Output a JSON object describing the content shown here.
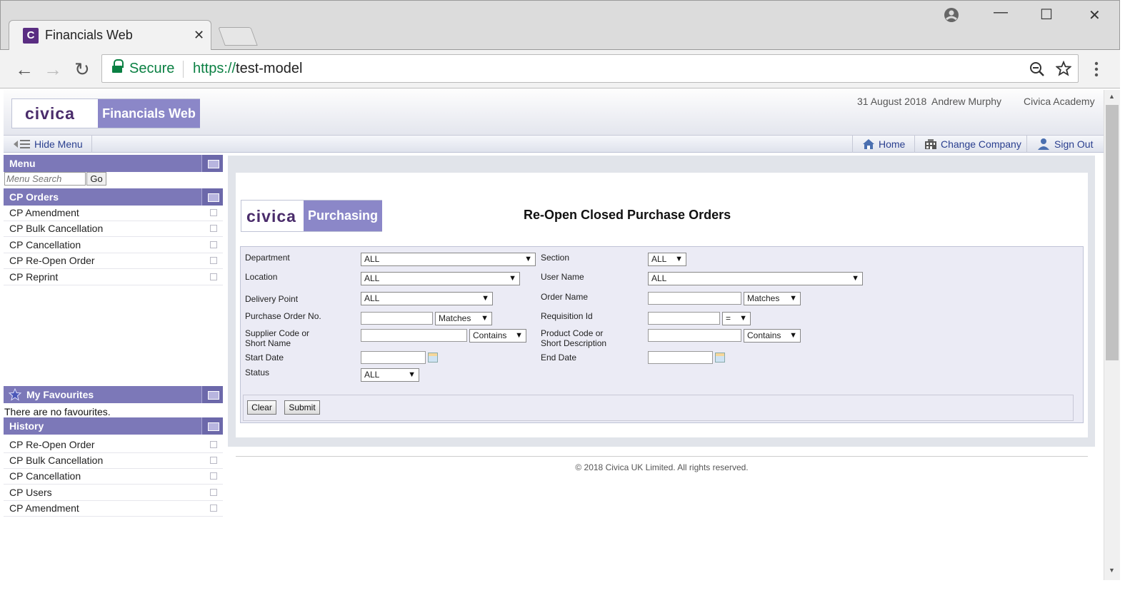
{
  "browser": {
    "tab_title": "Financials Web",
    "favicon_letter": "C",
    "tab_close": "✕",
    "window_controls": {
      "minimize": "—",
      "maximize": "☐",
      "close": "✕"
    },
    "nav": {
      "back": "←",
      "forward": "→",
      "reload": "↻"
    },
    "secure_label": "Secure",
    "url_scheme": "https://",
    "url_host": "test-model",
    "icons": {
      "zoom": "🔍",
      "star": "☆",
      "menu": "⋮",
      "account": "account-circle"
    }
  },
  "header": {
    "logo_word": "civica",
    "app_name": "Financials Web",
    "date": "31 August 2018",
    "user": "Andrew Murphy",
    "company": "Civica Academy"
  },
  "menubar": {
    "hide_menu": "Hide Menu",
    "home": "Home",
    "change_company": "Change Company",
    "sign_out": "Sign Out"
  },
  "sidebar": {
    "menu_title": "Menu",
    "search_placeholder": "Menu Search",
    "go_label": "Go",
    "cp_orders_title": "CP Orders",
    "cp_orders_items": [
      "CP Amendment",
      "CP Bulk Cancellation",
      "CP Cancellation",
      "CP Re-Open Order",
      "CP Reprint"
    ],
    "favourites_title": "My Favourites",
    "favourites_empty": "There are no favourites.",
    "history_title": "History",
    "history_items": [
      "CP Re-Open Order",
      "CP Bulk Cancellation",
      "CP Cancellation",
      "CP Users",
      "CP Amendment"
    ]
  },
  "content": {
    "logo_word": "civica",
    "module": "Purchasing",
    "title": "Re-Open Closed Purchase Orders",
    "form": {
      "department_label": "Department",
      "department_value": "ALL",
      "section_label": "Section",
      "section_value": "ALL",
      "location_label": "Location",
      "location_value": "ALL",
      "user_name_label": "User Name",
      "user_name_value": "ALL",
      "delivery_point_label": "Delivery Point",
      "delivery_point_value": "ALL",
      "order_name_label": "Order Name",
      "order_name_match": "Matches",
      "po_no_label": "Purchase Order No.",
      "po_no_match": "Matches",
      "requisition_label": "Requisition Id",
      "requisition_op": "=",
      "supplier_label_1": "Supplier Code or",
      "supplier_label_2": "Short Name",
      "supplier_match": "Contains",
      "product_label_1": "Product Code or",
      "product_label_2": "Short Description",
      "product_match": "Contains",
      "start_date_label": "Start Date",
      "end_date_label": "End Date",
      "status_label": "Status",
      "status_value": "ALL"
    },
    "clear_label": "Clear",
    "submit_label": "Submit"
  },
  "footer": "© 2018 Civica UK Limited. All rights reserved.",
  "colors": {
    "accent": "#7c78b8",
    "brand_purple": "#4a2c6b",
    "link": "#2a3f8f",
    "secure_green": "#0b8043"
  }
}
